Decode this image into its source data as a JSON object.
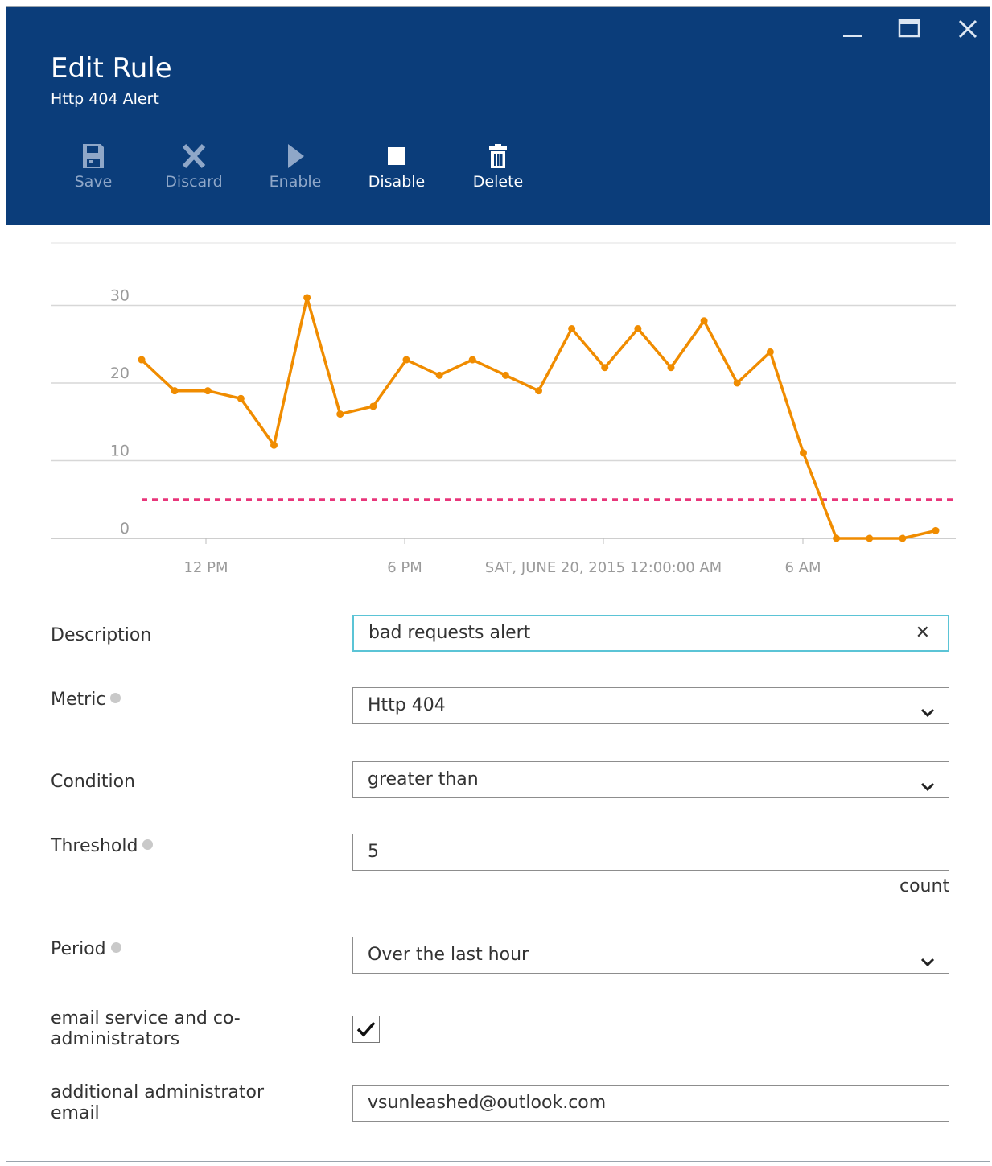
{
  "window": {
    "title": "Edit Rule",
    "subtitle": "Http 404 Alert",
    "controls": [
      "minimize-icon",
      "maximize-icon",
      "close-icon"
    ]
  },
  "toolbar": {
    "save": "Save",
    "discard": "Discard",
    "enable": "Enable",
    "disable": "Disable",
    "delete": "Delete"
  },
  "colors": {
    "header": "#0b3d7a",
    "series": "#f08c00",
    "threshold": "#e8357a",
    "focus_border": "#5bc4d6"
  },
  "chart_data": {
    "type": "line",
    "y_ticks": [
      "0",
      "10",
      "20",
      "30"
    ],
    "x_ticks": [
      "12 PM",
      "6 PM",
      "SAT, JUNE 20, 2015 12:00:00 AM",
      "6 AM"
    ],
    "ylim": [
      0,
      30
    ],
    "grid": true,
    "series": [
      {
        "values": [
          23,
          19,
          19,
          18,
          12,
          31,
          16,
          17,
          23,
          21,
          23,
          21,
          19,
          27,
          22,
          27,
          22,
          28,
          20,
          24,
          11,
          0,
          0,
          0,
          1
        ]
      }
    ],
    "threshold_line": 5
  },
  "form": {
    "description": {
      "label": "Description",
      "value": "bad requests alert"
    },
    "metric": {
      "label": "Metric",
      "value": "Http 404"
    },
    "condition": {
      "label": "Condition",
      "value": "greater than"
    },
    "threshold": {
      "label": "Threshold",
      "value": "5",
      "unit": "count"
    },
    "period": {
      "label": "Period",
      "value": "Over the last hour"
    },
    "email_admins": {
      "label_line1": "email service and co-",
      "label_line2": "administrators",
      "checked": true
    },
    "additional_email": {
      "label_line1": "additional administrator",
      "label_line2": "email",
      "value": "vsunleashed@outlook.com"
    }
  }
}
